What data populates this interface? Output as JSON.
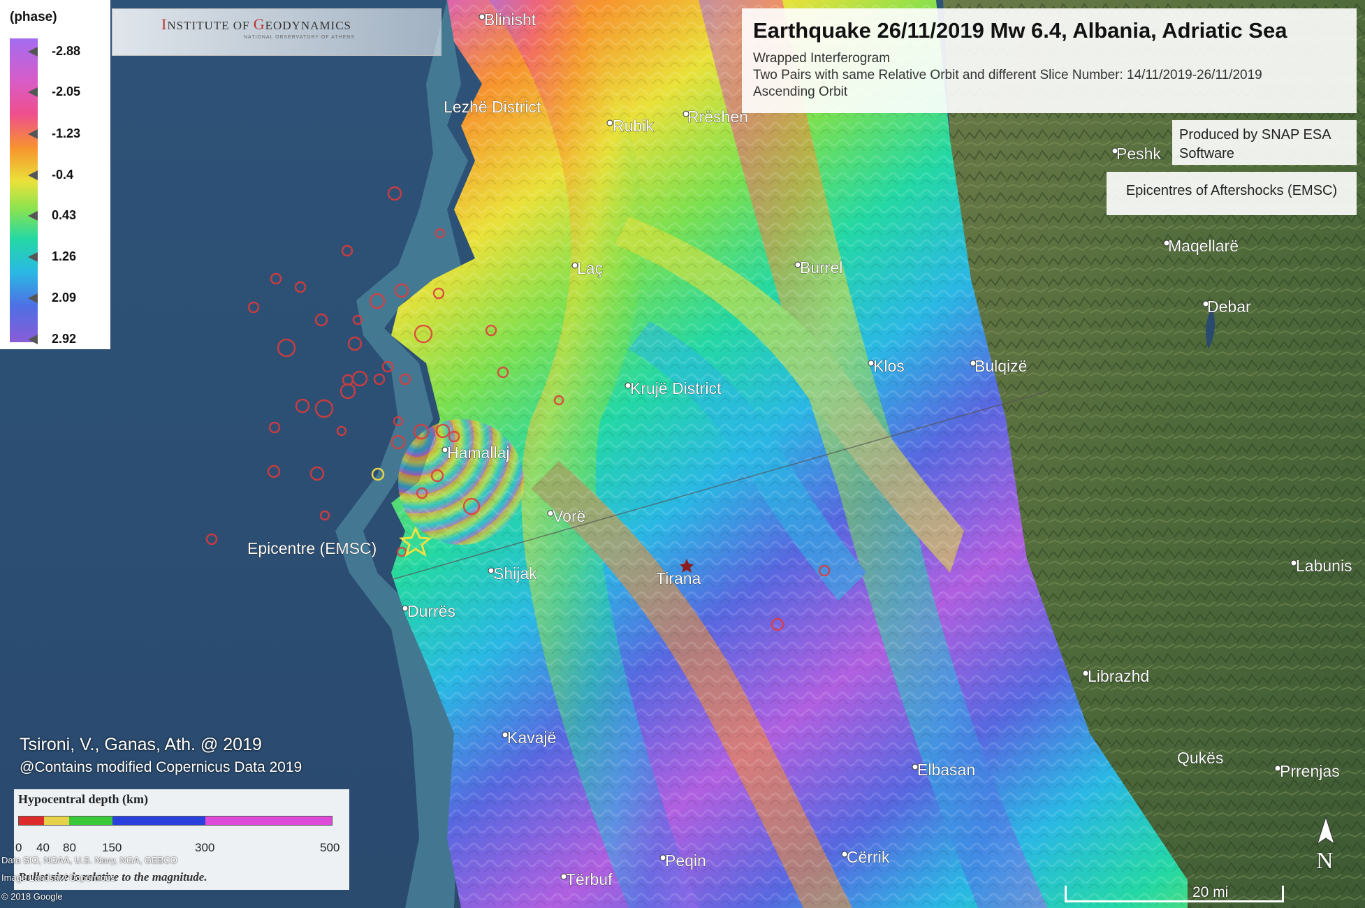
{
  "title_panel": {
    "title": "Earthquake 26/11/2019 Mw 6.4, Albania, Adriatic Sea",
    "line1": "Wrapped Interferogram",
    "line2": "Two Pairs with same Relative Orbit and different Slice Number: 14/11/2019-26/11/2019",
    "line3": "Ascending Orbit"
  },
  "software_note": "Produced by SNAP ESA Software",
  "aftershock_note": "Epicentres of Aftershocks (EMSC)",
  "logo": {
    "name_first_cap": "I",
    "name_first_rest": "NSTITUTE OF ",
    "name_second_cap": "G",
    "name_second_rest": "EODYNAMICS",
    "subtitle": "NATIONAL OBSERVATORY OF ATHENS"
  },
  "phase_legend": {
    "title": "(phase)",
    "ticks": [
      "-2.88",
      "-2.05",
      "-1.23",
      "-0.4",
      "0.43",
      "1.26",
      "2.09",
      "2.92"
    ],
    "colors": [
      "#a36cf0",
      "#d85cc8",
      "#ef4f8c",
      "#f7932e",
      "#eae13a",
      "#8be34f",
      "#24d8a4",
      "#2ab8e4",
      "#4e70e4",
      "#8a5cd8"
    ]
  },
  "authors": "Tsironi, V., Ganas, Ath. @ 2019",
  "copernicus": "@Contains modified Copernicus Data 2019",
  "depth_legend": {
    "title": "Hypocentral depth (km)",
    "labels": [
      "0",
      "40",
      "80",
      "150",
      "300",
      "500"
    ],
    "colors": [
      "#dd2a2a",
      "#e6d24a",
      "#38c838",
      "#2a40dd",
      "#dd4ad8"
    ],
    "note": "Bullet size is relative to the magnitude."
  },
  "attribution": [
    "Data SIO, NOAA, U.S. Navy, NGA, GEBCO",
    "Image Landsat / Copernicus",
    "© 2018 Google"
  ],
  "places": [
    {
      "name": "Blinisht"
    },
    {
      "name": "Lezhë District"
    },
    {
      "name": "Rubik"
    },
    {
      "name": "Rrëshen"
    },
    {
      "name": "Peshk"
    },
    {
      "name": "Maqellarë"
    },
    {
      "name": "Debar"
    },
    {
      "name": "Laç"
    },
    {
      "name": "Burrel"
    },
    {
      "name": "Klos"
    },
    {
      "name": "Bulqizë"
    },
    {
      "name": "Krujë District"
    },
    {
      "name": "Hamallaj"
    },
    {
      "name": "Vorë"
    },
    {
      "name": "Epicentre (EMSC)"
    },
    {
      "name": "Shijak"
    },
    {
      "name": "Tirana"
    },
    {
      "name": "Durrës"
    },
    {
      "name": "Librazhd"
    },
    {
      "name": "Labunis"
    },
    {
      "name": "Kavajë"
    },
    {
      "name": "Qukës"
    },
    {
      "name": "Prrenjas"
    },
    {
      "name": "Elbasan"
    },
    {
      "name": "Peqin"
    },
    {
      "name": "Cërrik"
    },
    {
      "name": "Tërbuf"
    }
  ],
  "scale_label": "20 mi",
  "north_label": "N"
}
